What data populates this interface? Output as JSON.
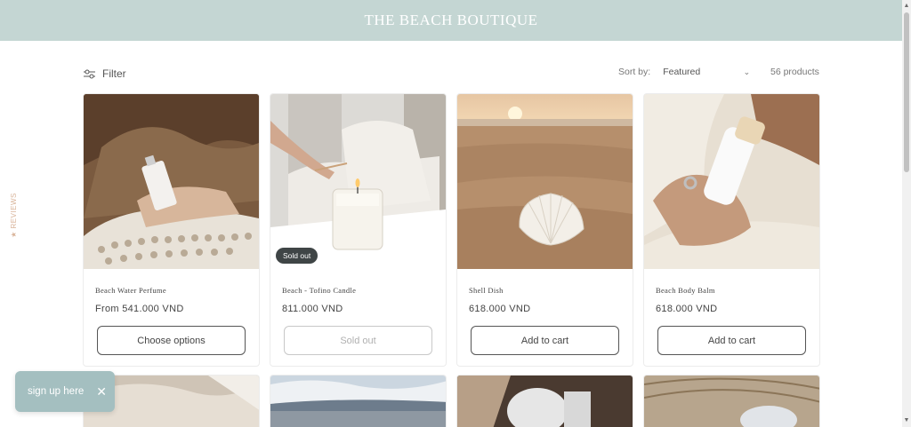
{
  "header": {
    "title": "THE BEACH BOUTIQUE"
  },
  "toolbar": {
    "filter_label": "Filter",
    "sort_label": "Sort by:",
    "sort_value": "Featured",
    "product_count": "56 products"
  },
  "reviews_tab": {
    "label": "★ REVIEWS"
  },
  "products": [
    {
      "name": "Beach Water Perfume",
      "price": "From 541.000 VND",
      "button": "Choose options",
      "sold_out": false
    },
    {
      "name": "Beach - Tofino Candle",
      "price": "811.000 VND",
      "button": "Sold out",
      "sold_out": true,
      "badge": "Sold out"
    },
    {
      "name": "Shell Dish",
      "price": "618.000 VND",
      "button": "Add to cart",
      "sold_out": false
    },
    {
      "name": "Beach Body Balm",
      "price": "618.000 VND",
      "button": "Add to cart",
      "sold_out": false
    }
  ],
  "signup": {
    "label": "sign up here",
    "close_icon": "close-icon"
  },
  "colors": {
    "header_bg": "#c4d6d3",
    "signup_bg": "#a4bfc0",
    "badge_bg": "#3f4546",
    "reviews_accent": "#d9b49a"
  }
}
